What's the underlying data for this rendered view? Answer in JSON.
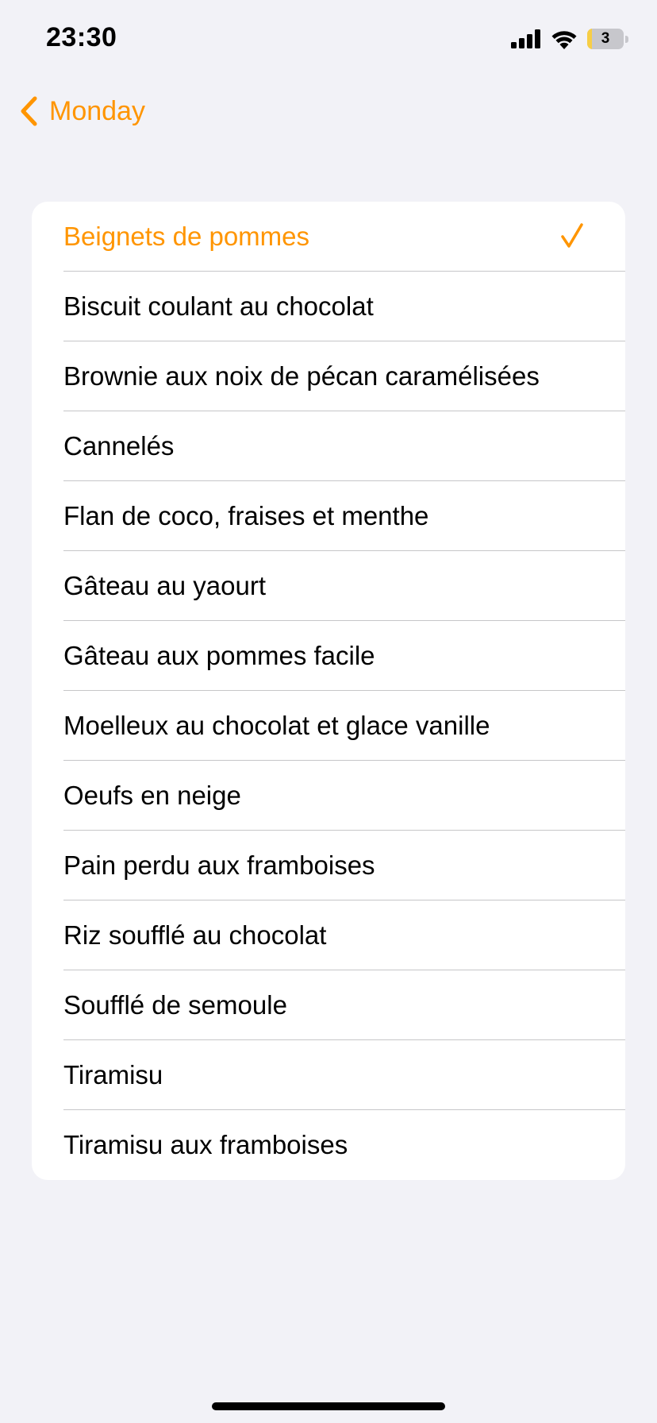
{
  "accent_color": "#ff9500",
  "status_bar": {
    "time": "23:30",
    "battery_level": "3",
    "icons": [
      "cellular-signal-icon",
      "wifi-icon",
      "battery-icon"
    ]
  },
  "nav": {
    "back_label": "Monday",
    "back_icon": "chevron-left-icon"
  },
  "list": {
    "selected_index": 0,
    "selected_icon": "checkmark-icon",
    "items": [
      {
        "label": "Beignets de pommes"
      },
      {
        "label": "Biscuit coulant au chocolat"
      },
      {
        "label": "Brownie aux noix de pécan caramélisées"
      },
      {
        "label": "Cannelés"
      },
      {
        "label": "Flan de coco, fraises et menthe"
      },
      {
        "label": "Gâteau au yaourt"
      },
      {
        "label": "Gâteau aux pommes facile"
      },
      {
        "label": "Moelleux au chocolat et glace vanille"
      },
      {
        "label": "Oeufs en neige"
      },
      {
        "label": "Pain perdu aux framboises"
      },
      {
        "label": "Riz soufflé au chocolat"
      },
      {
        "label": "Soufflé de semoule"
      },
      {
        "label": "Tiramisu"
      },
      {
        "label": "Tiramisu aux framboises"
      }
    ]
  }
}
